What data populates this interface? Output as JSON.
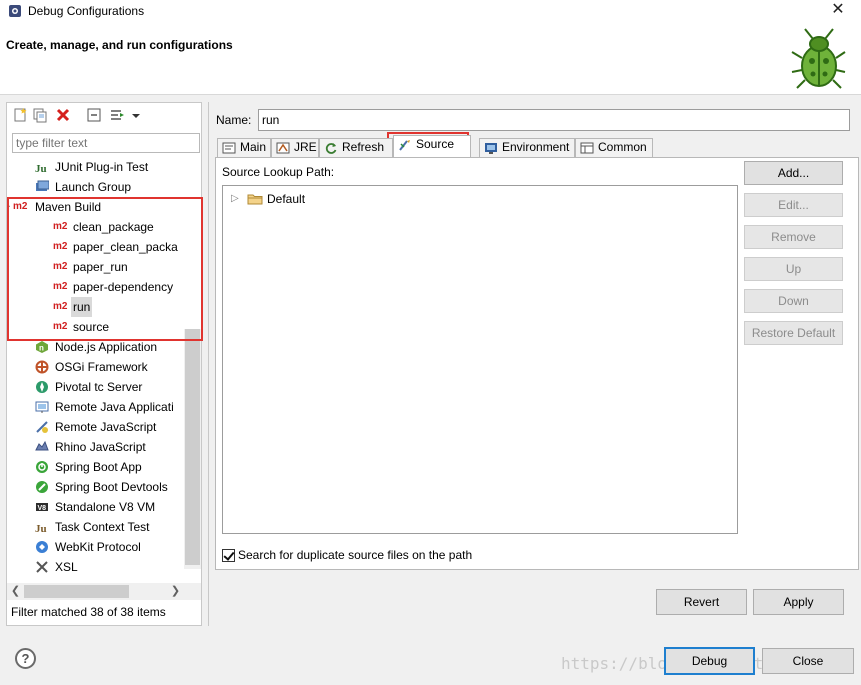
{
  "window": {
    "title": "Debug Configurations",
    "close_glyph": "✕"
  },
  "banner": {
    "heading": "Create, manage, and run configurations"
  },
  "left": {
    "filter_placeholder": "type filter text",
    "tree": [
      {
        "label": "JUnit Plug-in Test",
        "icon": "junit-icon"
      },
      {
        "label": "Launch Group",
        "icon": "launch-group-icon"
      },
      {
        "label": "Maven Build",
        "icon": "m2-icon",
        "expanded": true
      },
      {
        "label": "clean_package",
        "icon": "m2-icon",
        "child": true
      },
      {
        "label": "paper_clean_packa",
        "icon": "m2-icon",
        "child": true
      },
      {
        "label": "paper_run",
        "icon": "m2-icon",
        "child": true
      },
      {
        "label": "paper-dependency",
        "icon": "m2-icon",
        "child": true
      },
      {
        "label": "run",
        "icon": "m2-icon",
        "child": true,
        "selected": true
      },
      {
        "label": "source",
        "icon": "m2-icon",
        "child": true
      },
      {
        "label": "Node.js Application",
        "icon": "nodejs-icon"
      },
      {
        "label": "OSGi Framework",
        "icon": "osgi-icon"
      },
      {
        "label": "Pivotal tc Server",
        "icon": "pivotal-icon"
      },
      {
        "label": "Remote Java Applicati",
        "icon": "remote-java-icon"
      },
      {
        "label": "Remote JavaScript",
        "icon": "remote-js-icon"
      },
      {
        "label": "Rhino JavaScript",
        "icon": "rhino-icon"
      },
      {
        "label": "Spring Boot App",
        "icon": "spring-boot-icon"
      },
      {
        "label": "Spring Boot Devtools",
        "icon": "spring-devtools-icon"
      },
      {
        "label": "Standalone V8 VM",
        "icon": "v8-icon"
      },
      {
        "label": "Task Context Test",
        "icon": "task-context-icon"
      },
      {
        "label": "WebKit Protocol",
        "icon": "webkit-icon"
      },
      {
        "label": "XSL",
        "icon": "xsl-icon"
      }
    ],
    "status": "Filter matched 38 of 38 items",
    "m2_text": "m2"
  },
  "right": {
    "name_label": "Name:",
    "name_value": "run",
    "tabs": [
      {
        "label": "Main",
        "icon": "main-tab-icon"
      },
      {
        "label": "JRE",
        "icon": "jre-tab-icon"
      },
      {
        "label": "Refresh",
        "icon": "refresh-tab-icon"
      },
      {
        "label": "Source",
        "icon": "source-tab-icon",
        "active": true
      },
      {
        "label": "Environment",
        "icon": "environment-tab-icon"
      },
      {
        "label": "Common",
        "icon": "common-tab-icon"
      }
    ],
    "source_lookup_label": "Source Lookup Path:",
    "source_entries": [
      "Default"
    ],
    "side_buttons": [
      {
        "label": "Add...",
        "enabled": true
      },
      {
        "label": "Edit...",
        "enabled": false
      },
      {
        "label": "Remove",
        "enabled": false
      },
      {
        "label": "Up",
        "enabled": false
      },
      {
        "label": "Down",
        "enabled": false
      },
      {
        "label": "Restore Default",
        "enabled": false
      }
    ],
    "duplicate_checkbox_label": "Search for duplicate source files on the path",
    "duplicate_checked": true,
    "revert_label": "Revert",
    "apply_label": "Apply"
  },
  "footer": {
    "help_glyph": "?",
    "debug_label": "Debug",
    "close_label": "Close",
    "watermark": "https://blog.csdn.net/hohohh"
  },
  "colors": {
    "accent": "#1e7fcf",
    "highlight_box": "#e0342f",
    "m2": "#d02020"
  }
}
